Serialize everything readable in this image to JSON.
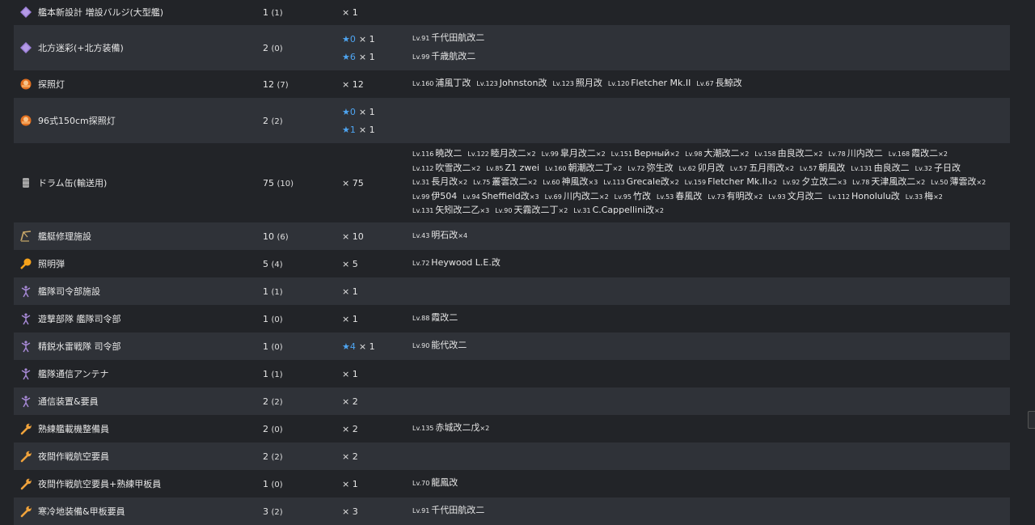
{
  "rows": [
    {
      "icon": "bulge-icon",
      "name": "艦本新設計 増設バルジ(大型艦)",
      "count": "1",
      "count_sub": "(1)",
      "mult": [
        {
          "star": "",
          "x": "× 1"
        }
      ],
      "ships": []
    },
    {
      "icon": "bulge-icon",
      "name": "北方迷彩(+北方装備)",
      "count": "2",
      "count_sub": "(0)",
      "mult": [
        {
          "star": "★0",
          "x": "× 1"
        },
        {
          "star": "★6",
          "x": "× 1"
        }
      ],
      "ships": [
        [
          {
            "lv": "Lv.91",
            "name": "千代田航改二",
            "n": ""
          }
        ],
        [
          {
            "lv": "Lv.99",
            "name": "千歳航改二",
            "n": ""
          }
        ]
      ]
    },
    {
      "icon": "searchlight-icon",
      "name": "探照灯",
      "count": "12",
      "count_sub": "(7)",
      "mult": [
        {
          "star": "",
          "x": "× 12"
        }
      ],
      "ships": [
        [
          {
            "lv": "Lv.160",
            "name": "浦風丁改",
            "n": ""
          },
          {
            "lv": "Lv.123",
            "name": "Johnston改",
            "n": ""
          },
          {
            "lv": "Lv.123",
            "name": "照月改",
            "n": ""
          },
          {
            "lv": "Lv.120",
            "name": "Fletcher Mk.II",
            "n": ""
          },
          {
            "lv": "Lv.67",
            "name": "長鯨改",
            "n": ""
          }
        ]
      ]
    },
    {
      "icon": "searchlight-icon",
      "name": "96式150cm探照灯",
      "count": "2",
      "count_sub": "(2)",
      "mult": [
        {
          "star": "★0",
          "x": "× 1"
        },
        {
          "star": "★1",
          "x": "× 1"
        }
      ],
      "ships": []
    },
    {
      "icon": "drum-icon",
      "name": "ドラム缶(輸送用)",
      "count": "75",
      "count_sub": "(10)",
      "mult": [
        {
          "star": "",
          "x": "× 75"
        }
      ],
      "ships": [
        [
          {
            "lv": "Lv.116",
            "name": "暁改二",
            "n": ""
          },
          {
            "lv": "Lv.122",
            "name": "睦月改二",
            "n": "×2"
          },
          {
            "lv": "Lv.99",
            "name": "皐月改二",
            "n": "×2"
          },
          {
            "lv": "Lv.151",
            "name": "Верный",
            "n": "×2"
          },
          {
            "lv": "Lv.98",
            "name": "大潮改二",
            "n": "×2"
          },
          {
            "lv": "Lv.158",
            "name": "由良改二",
            "n": "×2"
          },
          {
            "lv": "Lv.78",
            "name": "川内改二",
            "n": ""
          },
          {
            "lv": "Lv.168",
            "name": "霞改二",
            "n": "×2"
          }
        ],
        [
          {
            "lv": "Lv.112",
            "name": "吹雪改二",
            "n": "×2"
          },
          {
            "lv": "Lv.85",
            "name": "Z1 zwei",
            "n": ""
          },
          {
            "lv": "Lv.160",
            "name": "朝潮改二丁",
            "n": "×2"
          },
          {
            "lv": "Lv.72",
            "name": "弥生改",
            "n": ""
          },
          {
            "lv": "Lv.62",
            "name": "卯月改",
            "n": ""
          },
          {
            "lv": "Lv.57",
            "name": "五月雨改",
            "n": "×2"
          },
          {
            "lv": "Lv.57",
            "name": "朝風改",
            "n": ""
          },
          {
            "lv": "Lv.131",
            "name": "由良改二",
            "n": ""
          },
          {
            "lv": "Lv.32",
            "name": "子日改",
            "n": ""
          }
        ],
        [
          {
            "lv": "Lv.31",
            "name": "長月改",
            "n": "×2"
          },
          {
            "lv": "Lv.75",
            "name": "叢雲改二",
            "n": "×2"
          },
          {
            "lv": "Lv.60",
            "name": "神風改",
            "n": "×3"
          },
          {
            "lv": "Lv.113",
            "name": "Grecale改",
            "n": "×2"
          },
          {
            "lv": "Lv.159",
            "name": "Fletcher Mk.II",
            "n": "×2"
          },
          {
            "lv": "Lv.92",
            "name": "夕立改二",
            "n": "×3"
          },
          {
            "lv": "Lv.78",
            "name": "天津風改二",
            "n": "×2"
          },
          {
            "lv": "Lv.50",
            "name": "薄雲改",
            "n": "×2"
          }
        ],
        [
          {
            "lv": "Lv.99",
            "name": "伊504",
            "n": ""
          },
          {
            "lv": "Lv.94",
            "name": "Sheffield改",
            "n": "×3"
          },
          {
            "lv": "Lv.69",
            "name": "川内改二",
            "n": "×2"
          },
          {
            "lv": "Lv.95",
            "name": "竹改",
            "n": ""
          },
          {
            "lv": "Lv.53",
            "name": "春風改",
            "n": ""
          },
          {
            "lv": "Lv.73",
            "name": "有明改",
            "n": "×2"
          },
          {
            "lv": "Lv.93",
            "name": "文月改二",
            "n": ""
          },
          {
            "lv": "Lv.112",
            "name": "Honolulu改",
            "n": ""
          },
          {
            "lv": "Lv.33",
            "name": "梅",
            "n": "×2"
          }
        ],
        [
          {
            "lv": "Lv.131",
            "name": "矢矧改二乙",
            "n": "×3"
          },
          {
            "lv": "Lv.90",
            "name": "天霧改二丁",
            "n": "×2"
          },
          {
            "lv": "Lv.31",
            "name": "C.Cappellini改",
            "n": "×2"
          }
        ]
      ]
    },
    {
      "icon": "repair-crane-icon",
      "name": "艦艇修理施設",
      "count": "10",
      "count_sub": "(6)",
      "mult": [
        {
          "star": "",
          "x": "× 10"
        }
      ],
      "ships": [
        [
          {
            "lv": "Lv.43",
            "name": "明石改",
            "n": "×4"
          }
        ]
      ]
    },
    {
      "icon": "flare-icon",
      "name": "照明弾",
      "count": "5",
      "count_sub": "(4)",
      "mult": [
        {
          "star": "",
          "x": "× 5"
        }
      ],
      "ships": [
        [
          {
            "lv": "Lv.72",
            "name": "Heywood L.E.改",
            "n": ""
          }
        ]
      ]
    },
    {
      "icon": "command-icon",
      "name": "艦隊司令部施設",
      "count": "1",
      "count_sub": "(1)",
      "mult": [
        {
          "star": "",
          "x": "× 1"
        }
      ],
      "ships": []
    },
    {
      "icon": "command-icon",
      "name": "遊撃部隊 艦隊司令部",
      "count": "1",
      "count_sub": "(0)",
      "mult": [
        {
          "star": "",
          "x": "× 1"
        }
      ],
      "ships": [
        [
          {
            "lv": "Lv.88",
            "name": "霞改二",
            "n": ""
          }
        ]
      ]
    },
    {
      "icon": "command-icon",
      "name": "精鋭水雷戦隊 司令部",
      "count": "1",
      "count_sub": "(0)",
      "mult": [
        {
          "star": "★4",
          "x": "× 1"
        }
      ],
      "ships": [
        [
          {
            "lv": "Lv.90",
            "name": "能代改二",
            "n": ""
          }
        ]
      ]
    },
    {
      "icon": "command-icon",
      "name": "艦隊通信アンテナ",
      "count": "1",
      "count_sub": "(1)",
      "mult": [
        {
          "star": "",
          "x": "× 1"
        }
      ],
      "ships": []
    },
    {
      "icon": "command-icon",
      "name": "通信装置&要員",
      "count": "2",
      "count_sub": "(2)",
      "mult": [
        {
          "star": "",
          "x": "× 2"
        }
      ],
      "ships": []
    },
    {
      "icon": "wrench-icon",
      "name": "熟練艦載機整備員",
      "count": "2",
      "count_sub": "(0)",
      "mult": [
        {
          "star": "",
          "x": "× 2"
        }
      ],
      "ships": [
        [
          {
            "lv": "Lv.135",
            "name": "赤城改二戊",
            "n": "×2"
          }
        ]
      ]
    },
    {
      "icon": "wrench-icon",
      "name": "夜間作戦航空要員",
      "count": "2",
      "count_sub": "(2)",
      "mult": [
        {
          "star": "",
          "x": "× 2"
        }
      ],
      "ships": []
    },
    {
      "icon": "wrench-icon",
      "name": "夜間作戦航空要員+熟練甲板員",
      "count": "1",
      "count_sub": "(0)",
      "mult": [
        {
          "star": "",
          "x": "× 1"
        }
      ],
      "ships": [
        [
          {
            "lv": "Lv.70",
            "name": "龍鳳改",
            "n": ""
          }
        ]
      ]
    },
    {
      "icon": "wrench-icon",
      "name": "寒冷地装備&甲板要員",
      "count": "3",
      "count_sub": "(2)",
      "mult": [
        {
          "star": "",
          "x": "× 3"
        }
      ],
      "ships": [
        [
          {
            "lv": "Lv.91",
            "name": "千代田航改二",
            "n": ""
          }
        ]
      ]
    }
  ]
}
